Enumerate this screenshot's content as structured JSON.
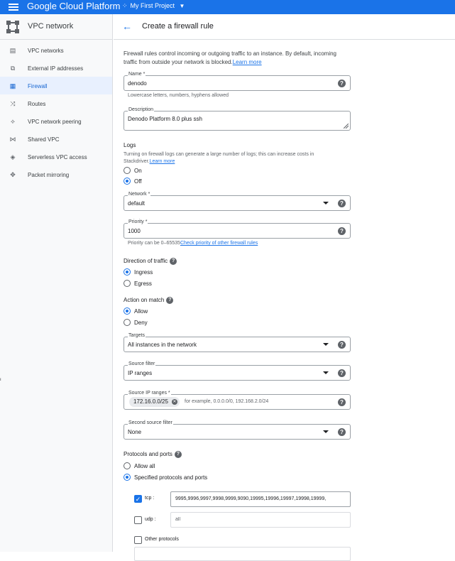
{
  "topbar": {
    "brand": "Google Cloud Platform",
    "project": "My First Project"
  },
  "sidebar": {
    "title": "VPC network",
    "items": [
      {
        "label": "VPC networks",
        "icon": "vpc-networks-icon"
      },
      {
        "label": "External IP addresses",
        "icon": "external-ip-icon"
      },
      {
        "label": "Firewall",
        "icon": "firewall-icon"
      },
      {
        "label": "Routes",
        "icon": "routes-icon"
      },
      {
        "label": "VPC network peering",
        "icon": "peering-icon"
      },
      {
        "label": "Shared VPC",
        "icon": "shared-vpc-icon"
      },
      {
        "label": "Serverless VPC access",
        "icon": "serverless-icon"
      },
      {
        "label": "Packet mirroring",
        "icon": "packet-mirroring-icon"
      }
    ],
    "active": "Firewall"
  },
  "header": {
    "title": "Create a firewall rule"
  },
  "form": {
    "intro": "Firewall rules control incoming or outgoing traffic to an instance. By default, incoming traffic from outside your network is blocked.",
    "intro_link": "Learn more",
    "name_label": "Name *",
    "name_value": "denodo",
    "name_hint": "Lowercase letters, numbers, hyphens allowed",
    "desc_label": "Description",
    "desc_value": "Denodo Platform 8.0 plus ssh",
    "logs_title": "Logs",
    "logs_text": "Turning on firewall logs can generate a large number of logs; this can increase costs in Stackdriver.",
    "logs_link": "Learn more",
    "logs_on": "On",
    "logs_off": "Off",
    "network_label": "Network *",
    "network_value": "default",
    "priority_label": "Priority *",
    "priority_value": "1000",
    "priority_hint": "Priority can be 0–65535",
    "priority_link": "Check priority of other firewall rules",
    "direction_title": "Direction of traffic",
    "ingress": "Ingress",
    "egress": "Egress",
    "action_title": "Action on match",
    "allow": "Allow",
    "deny": "Deny",
    "targets_label": "Targets",
    "targets_value": "All instances in the network",
    "source_filter_label": "Source filter",
    "source_filter_value": "IP ranges",
    "source_ip_label": "Source IP ranges *",
    "source_ip_chip": "172.16.0.0/25",
    "source_ip_placeholder": "for example, 0.0.0.0/0, 192.168.2.0/24",
    "second_filter_label": "Second source filter",
    "second_filter_value": "None",
    "protocols_title": "Protocols and ports",
    "allow_all": "Allow all",
    "specified": "Specified protocols and ports",
    "tcp_label": "tcp :",
    "tcp_value": "9995,9996,9997,9998,9999,9090,19995,19996,19997,19998,19999,",
    "udp_label": "udp :",
    "udp_placeholder": "all",
    "other_label": "Other protocols"
  },
  "colors": {
    "accent": "#1a73e8",
    "topbar": "#1a73e8",
    "active_bg": "#e8f0fe"
  }
}
